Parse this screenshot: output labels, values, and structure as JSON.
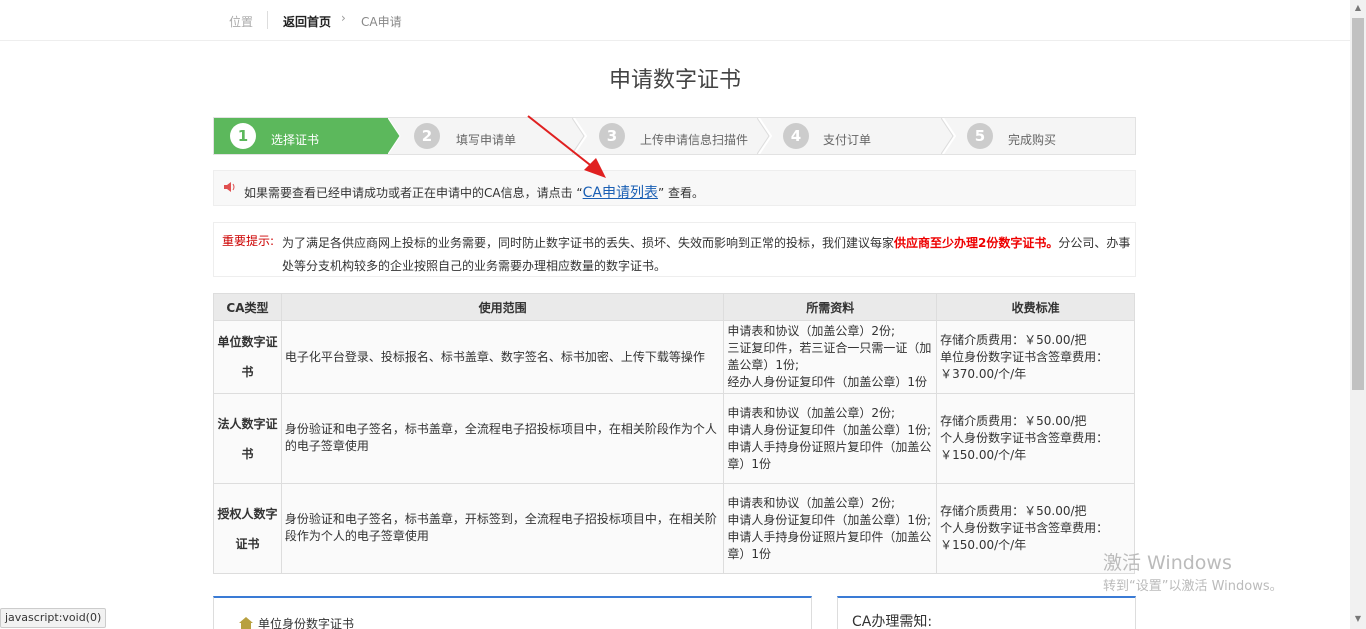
{
  "breadcrumb": {
    "position": "位置",
    "home": "返回首页",
    "arrow": "›",
    "current": "CA申请"
  },
  "title": "申请数字证书",
  "steps": [
    {
      "num": "1",
      "label": "选择证书"
    },
    {
      "num": "2",
      "label": "填写申请单"
    },
    {
      "num": "3",
      "label": "上传申请信息扫描件"
    },
    {
      "num": "4",
      "label": "支付订单"
    },
    {
      "num": "5",
      "label": "完成购买"
    }
  ],
  "active_step": 1,
  "notice": {
    "prefix": "如果需要查看已经申请成功或者正在申请中的CA信息，请点击 “",
    "link": "CA申请列表",
    "suffix": "” 查看。"
  },
  "important": {
    "label": "重要提示:",
    "text_1": "为了满足各供应商网上投标的业务需要，同时防止数字证书的丢失、损坏、失效而影响到正常的投标，我们建议每家",
    "strong": "供应商至少办理2份数字证书。",
    "text_2": "分公司、办事处等分支机构较多的企业按照自己的业务需要办理相应数量的数字证书。"
  },
  "table": {
    "headers": [
      "CA类型",
      "使用范围",
      "所需资料",
      "收费标准"
    ],
    "rows": [
      {
        "type": "单位数字证书",
        "scope": "电子化平台登录、投标报名、标书盖章、数字签名、标书加密、上传下载等操作",
        "materials": [
          "申请表和协议（加盖公章）2份;",
          "三证复印件，若三证合一只需一证（加盖公章）1份;",
          "经办人身份证复印件（加盖公章）1份"
        ],
        "fees": [
          "存储介质费用：￥50.00/把",
          "单位身份数字证书含签章费用：￥370.00/个/年"
        ]
      },
      {
        "type": "法人数字证书",
        "scope": "身份验证和电子签名，标书盖章，全流程电子招投标项目中，在相关阶段作为个人的电子签章使用",
        "materials": [
          "申请表和协议（加盖公章）2份;",
          "申请人身份证复印件（加盖公章）1份;",
          "申请人手持身份证照片复印件（加盖公章）1份"
        ],
        "fees": [
          "存储介质费用：￥50.00/把",
          "个人身份数字证书含签章费用：￥150.00/个/年"
        ]
      },
      {
        "type": "授权人数字证书",
        "scope": "身份验证和电子签名，标书盖章，开标签到，全流程电子招投标项目中，在相关阶段作为个人的电子签章使用",
        "materials": [
          "申请表和协议（加盖公章）2份;",
          "申请人身份证复印件（加盖公章）1份;",
          "申请人手持身份证照片复印件（加盖公章）1份"
        ],
        "fees": [
          "存储介质费用：￥50.00/把",
          "个人身份数字证书含签章费用：￥150.00/个/年"
        ]
      }
    ]
  },
  "box_left_title": "单位身份数字证书",
  "box_right_title": "CA办理需知:",
  "status_bar": "javascript:void(0)",
  "watermark": {
    "line1": "激活 Windows",
    "line2": "转到“设置”以激活 Windows。"
  },
  "colors": {
    "step_active": "#5cb85c",
    "link": "#1a5fb4",
    "important": "#e00",
    "arrow": "#e02020"
  },
  "icons": {
    "notice": "speaker-icon",
    "box": "home-icon"
  }
}
